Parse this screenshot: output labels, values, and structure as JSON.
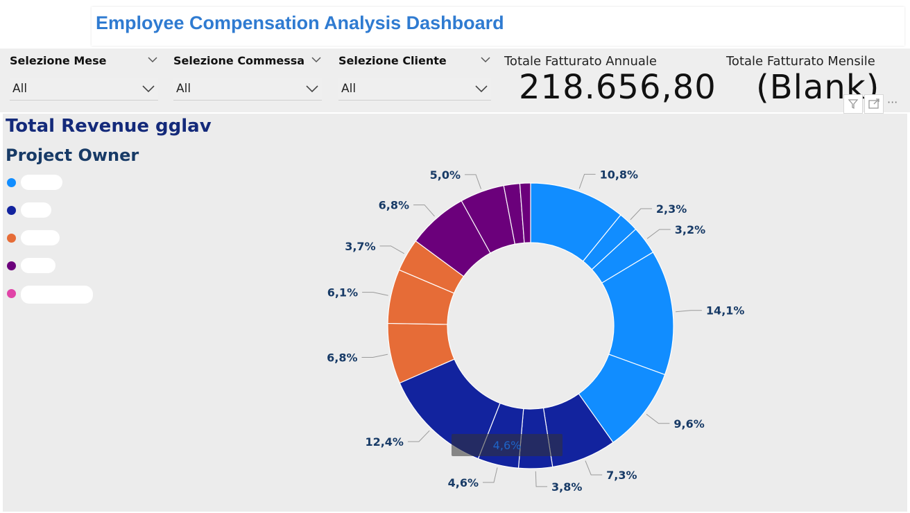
{
  "header": {
    "title": "Employee Compensation Analysis Dashboard"
  },
  "slicers": [
    {
      "title": "Selezione Mese",
      "value": "All"
    },
    {
      "title": "Selezione Commessa",
      "value": "All"
    },
    {
      "title": "Selezione Cliente",
      "value": "All"
    }
  ],
  "kpis": [
    {
      "label": "Totale Fatturato Annuale",
      "value": "218.656,80"
    },
    {
      "label": "Totale Fatturato Mensile",
      "value": "(Blank)"
    }
  ],
  "toolbar": {
    "icons": [
      "filter-icon",
      "focus-mode-icon",
      "more-options-icon"
    ],
    "more_label": "···"
  },
  "chart_data": {
    "type": "pie",
    "subtype": "donut",
    "title": "Total Revenue gglav",
    "legend_title": "Project Owner",
    "legend_placement": "left",
    "legend": [
      {
        "name": "",
        "color": "#118dff"
      },
      {
        "name": "",
        "color": "#12239e"
      },
      {
        "name": "",
        "color": "#e66c37"
      },
      {
        "name": "",
        "color": "#6b007b"
      },
      {
        "name": "",
        "color": "#e044a7"
      }
    ],
    "slices": [
      {
        "label": "",
        "value": 10.8,
        "value_label": "10,8%",
        "color": "#118dff"
      },
      {
        "label": "",
        "value": 2.3,
        "value_label": "2,3%",
        "color": "#118dff"
      },
      {
        "label": "",
        "value": 3.2,
        "value_label": "3,2%",
        "color": "#118dff"
      },
      {
        "label": "",
        "value": 14.1,
        "value_label": "14,1%",
        "color": "#118dff"
      },
      {
        "label": "",
        "value": 9.6,
        "value_label": "9,6%",
        "color": "#118dff"
      },
      {
        "label": "",
        "value": 7.3,
        "value_label": "7,3%",
        "color": "#12239e"
      },
      {
        "label": "",
        "value": 3.8,
        "value_label": "3,8%",
        "color": "#12239e"
      },
      {
        "label": "",
        "value": 4.6,
        "value_label": "4,6%",
        "color": "#12239e"
      },
      {
        "label": "",
        "value": 12.4,
        "value_label": "12,4%",
        "color": "#12239e"
      },
      {
        "label": "",
        "value": 6.8,
        "value_label": "6,8%",
        "color": "#e66c37"
      },
      {
        "label": "",
        "value": 6.1,
        "value_label": "6,1%",
        "color": "#e66c37"
      },
      {
        "label": "",
        "value": 3.7,
        "value_label": "3,7%",
        "color": "#e66c37"
      },
      {
        "label": "",
        "value": 6.8,
        "value_label": "6,8%",
        "color": "#6b007b"
      },
      {
        "label": "",
        "value": 5.0,
        "value_label": "5,0%",
        "color": "#6b007b"
      },
      {
        "label": "",
        "value": 1.8,
        "value_label": "",
        "color": "#6b007b"
      },
      {
        "label": "",
        "value": 1.2,
        "value_label": "",
        "color": "#6b007b"
      }
    ],
    "tooltip": {
      "label": "",
      "value_label": "4,6%"
    }
  }
}
